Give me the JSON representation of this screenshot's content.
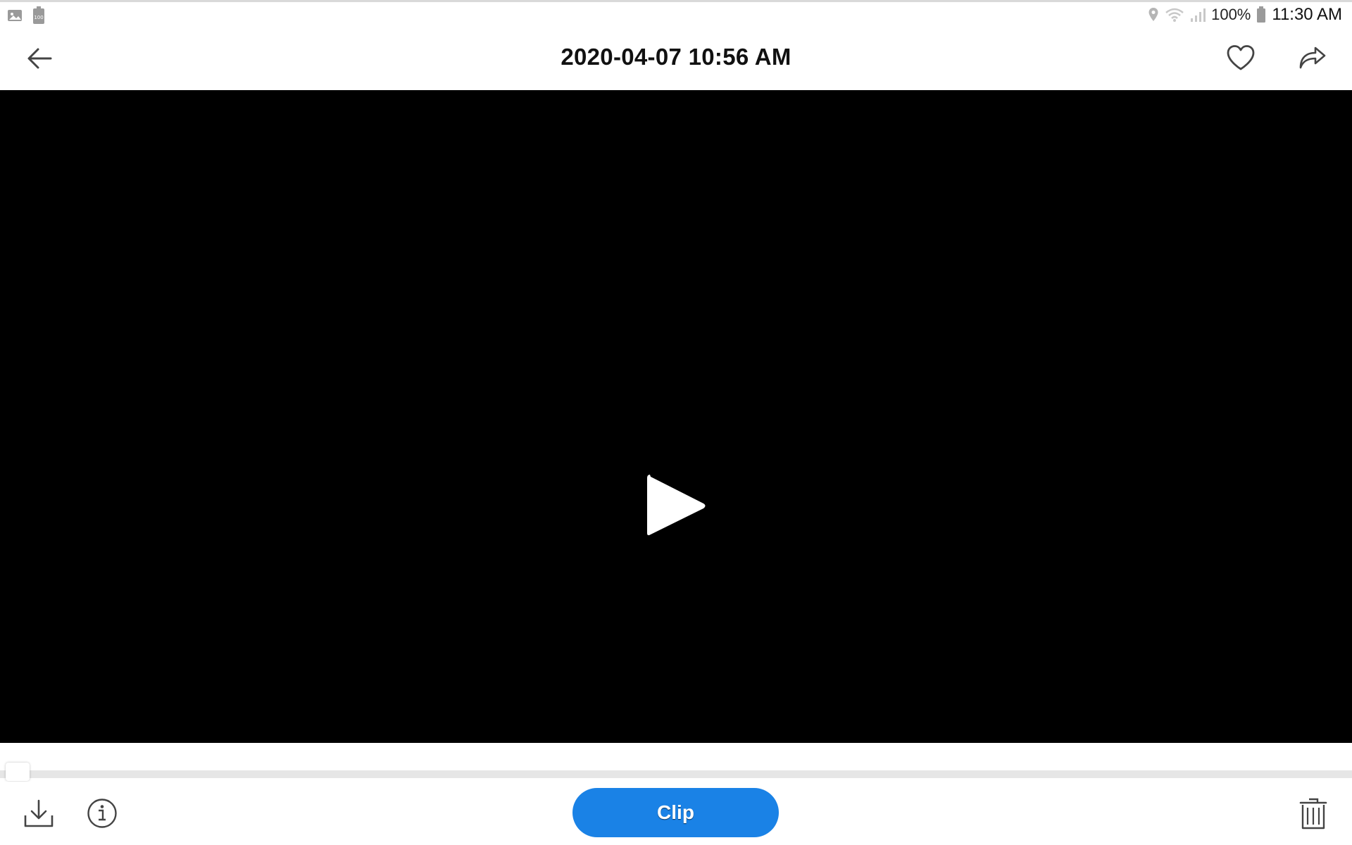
{
  "status_bar": {
    "left_icons": [
      "gallery-icon",
      "battery-100-icon"
    ],
    "battery_badge": "100",
    "battery_percent": "100%",
    "time": "11:30 AM",
    "right_icons": [
      "location-icon",
      "wifi-icon",
      "signal-icon",
      "battery-icon"
    ]
  },
  "app_bar": {
    "title": "2020-04-07 10:56 AM",
    "icons": {
      "back": "arrow-back-icon",
      "favorite": "heart-outline-icon",
      "share": "share-forward-icon"
    }
  },
  "player": {
    "icon": "play-icon",
    "progress": 0
  },
  "bottom_bar": {
    "clip_label": "Clip",
    "icons": {
      "download": "download-icon",
      "info": "info-icon",
      "delete": "trash-icon"
    }
  },
  "colors": {
    "accent": "#1a82e6",
    "video_background": "#000000",
    "icon": "#444444"
  }
}
